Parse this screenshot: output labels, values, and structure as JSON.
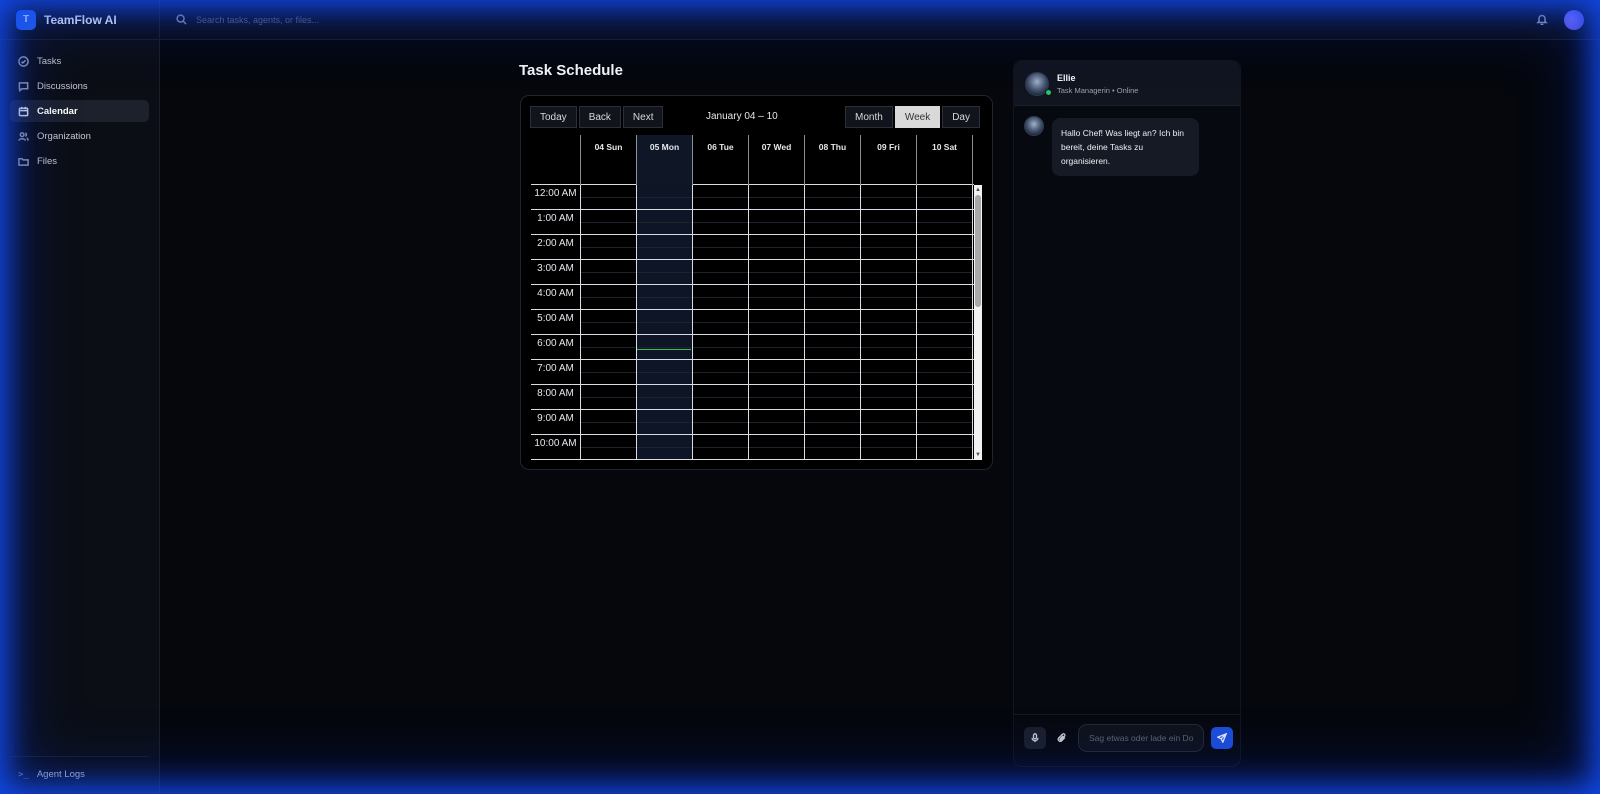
{
  "app": {
    "logo_letter": "T",
    "name": "TeamFlow AI"
  },
  "sidebar": {
    "items": [
      {
        "label": "Tasks",
        "icon": "check-circle-icon",
        "active": false
      },
      {
        "label": "Discussions",
        "icon": "message-icon",
        "active": false
      },
      {
        "label": "Calendar",
        "icon": "calendar-icon",
        "active": true
      },
      {
        "label": "Organization",
        "icon": "users-icon",
        "active": false
      },
      {
        "label": "Files",
        "icon": "folder-icon",
        "active": false
      }
    ],
    "footer": {
      "label": "Agent Logs",
      "icon": "terminal-icon",
      "glyph": ">_"
    }
  },
  "topbar": {
    "search_placeholder": "Search tasks, agents, or files...",
    "notification_icon": "bell-icon",
    "avatar_color": "#6d5dfc"
  },
  "page": {
    "title": "Task Schedule"
  },
  "calendar": {
    "nav_buttons": [
      "Today",
      "Back",
      "Next"
    ],
    "range_label": "January 04 – 10",
    "views": [
      "Month",
      "Week",
      "Day"
    ],
    "active_view": "Week",
    "days": [
      "04 Sun",
      "05 Mon",
      "06 Tue",
      "07 Wed",
      "08 Thu",
      "09 Fri",
      "10 Sat"
    ],
    "today": "05 Mon",
    "times": [
      "12:00 AM",
      "1:00 AM",
      "2:00 AM",
      "3:00 AM",
      "4:00 AM",
      "5:00 AM",
      "6:00 AM",
      "7:00 AM",
      "8:00 AM",
      "9:00 AM",
      "10:00 AM"
    ]
  },
  "chat": {
    "agent_name": "Ellie",
    "agent_role": "Task Managerin • Online",
    "messages": [
      {
        "from": "Ellie",
        "text": "Hallo Chef! Was liegt an? Ich bin bereit, deine Tasks zu organisieren."
      }
    ],
    "input_placeholder": "Sag etwas oder lade ein Do",
    "status_color": "#22c55e",
    "accent": "#1d4ed8"
  }
}
